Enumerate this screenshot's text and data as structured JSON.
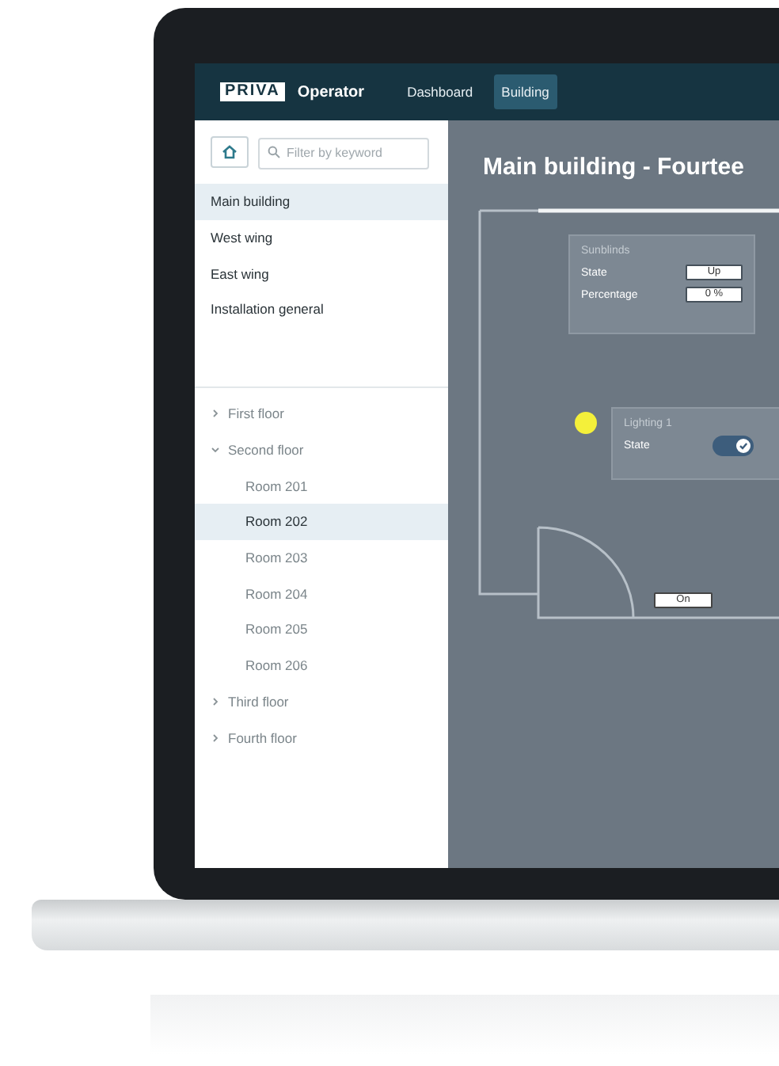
{
  "header": {
    "logo": "PRIVA",
    "app_name": "Operator",
    "nav": [
      {
        "label": "Dashboard",
        "selected": false
      },
      {
        "label": "Building",
        "selected": true
      }
    ]
  },
  "sidebar": {
    "search": {
      "placeholder": "Filter by keyword"
    },
    "buildings": [
      {
        "label": "Main building",
        "selected": true
      },
      {
        "label": "West wing",
        "selected": false
      },
      {
        "label": "East wing",
        "selected": false
      },
      {
        "label": "Installation general",
        "selected": false
      }
    ],
    "floors": [
      {
        "label": "First floor",
        "expanded": false
      },
      {
        "label": "Second floor",
        "expanded": true,
        "children": [
          {
            "label": "Room 201",
            "selected": false
          },
          {
            "label": "Room 202",
            "selected": true
          },
          {
            "label": "Room 203",
            "selected": false
          },
          {
            "label": "Room 204",
            "selected": false
          },
          {
            "label": "Room 205",
            "selected": false
          },
          {
            "label": "Room 206",
            "selected": false
          }
        ]
      },
      {
        "label": "Third floor",
        "expanded": false
      },
      {
        "label": "Fourth floor",
        "expanded": false
      }
    ]
  },
  "main": {
    "title": "Main building - Fourtee",
    "sunblinds": {
      "title": "Sunblinds",
      "rows": [
        {
          "label": "State",
          "value": "Up"
        },
        {
          "label": "Percentage",
          "value": "0 %"
        }
      ]
    },
    "lighting": {
      "title": "Lighting 1",
      "label": "State",
      "on": true
    },
    "door_button": "On"
  }
}
